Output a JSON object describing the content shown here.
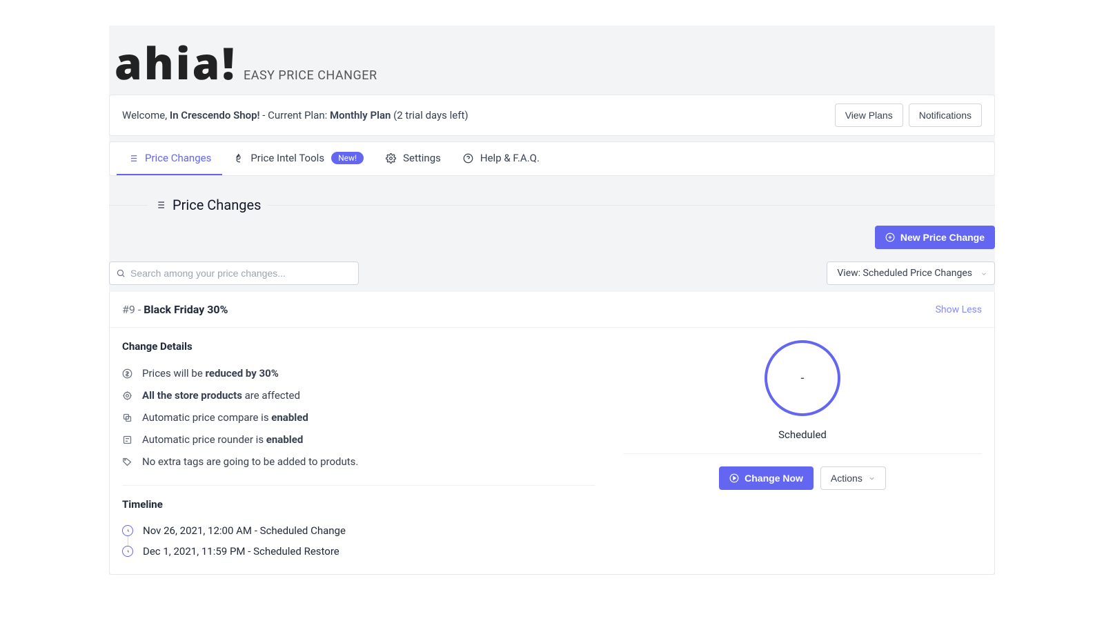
{
  "brand": {
    "logo": "ahia!",
    "tagline": "EASY PRICE CHANGER"
  },
  "welcome": {
    "prefix": "Welcome, ",
    "shop_name": "In Crescendo Shop!",
    "plan_prefix": " - Current Plan: ",
    "plan_name": "Monthly Plan",
    "trial_suffix": " (2 trial days left)",
    "view_plans": "View Plans",
    "notifications": "Notifications"
  },
  "tabs": {
    "price_changes": "Price Changes",
    "intel": "Price Intel Tools",
    "intel_badge": "New!",
    "settings": "Settings",
    "help": "Help & F.A.Q."
  },
  "section_title": "Price Changes",
  "actions": {
    "new_price_change": "New Price Change",
    "view_select_full": "View: Scheduled Price Changes",
    "search_placeholder": "Search among your price changes..."
  },
  "card": {
    "id_prefix": "#9 - ",
    "name": "Black Friday 30%",
    "show_less": "Show Less",
    "details_heading": "Change Details",
    "details": {
      "price_pre": "Prices will be ",
      "price_bold": "reduced by 30%",
      "scope_bold": "All the store products",
      "scope_post": " are affected",
      "compare_pre": "Automatic price compare is ",
      "compare_bold": "enabled",
      "round_pre": "Automatic price rounder is ",
      "round_bold": "enabled",
      "tags": "No extra tags are going to be added to produts."
    },
    "timeline_heading": "Timeline",
    "timeline": [
      "Nov 26, 2021, 12:00 AM - Scheduled Change",
      "Dec 1, 2021, 11:59 PM - Scheduled Restore"
    ],
    "progress_value": "-",
    "status": "Scheduled",
    "change_now": "Change Now",
    "actions_label": "Actions"
  }
}
